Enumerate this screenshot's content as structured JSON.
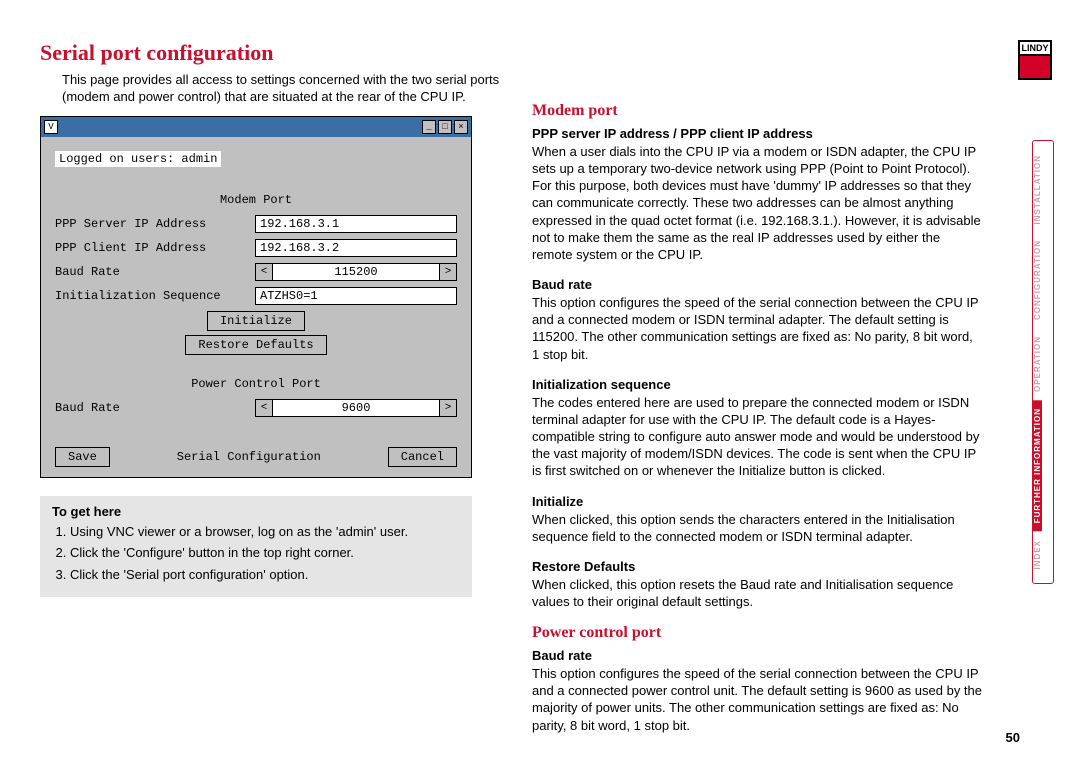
{
  "logo": {
    "text": "LINDY"
  },
  "title": "Serial port configuration",
  "intro": "This page provides all access to settings concerned with the two serial ports (modem and power control) that are situated at the rear of the CPU IP.",
  "screenshot": {
    "logged_on": "Logged on users: admin",
    "modem_section": "Modem Port",
    "labels": {
      "ppp_server": "PPP Server IP Address",
      "ppp_client": "PPP Client IP Address",
      "baud": "Baud Rate",
      "init_seq": "Initialization Sequence"
    },
    "values": {
      "ppp_server": "192.168.3.1",
      "ppp_client": "192.168.3.2",
      "modem_baud": "115200",
      "init_seq": "ATZHS0=1",
      "power_baud": "9600"
    },
    "buttons": {
      "initialize": "Initialize",
      "restore": "Restore Defaults",
      "save": "Save",
      "cancel": "Cancel"
    },
    "power_section": "Power Control Port",
    "bottom_title": "Serial Configuration"
  },
  "howto": {
    "heading": "To get here",
    "steps": [
      "Using VNC viewer or a browser, log on as the 'admin' user.",
      "Click the 'Configure' button in the top right corner.",
      "Click the 'Serial port configuration' option."
    ]
  },
  "right": {
    "modem_heading": "Modem port",
    "ppp": {
      "h": "PPP server IP address / PPP client IP address",
      "p": "When a user dials into the CPU IP via a modem or ISDN adapter, the CPU IP sets up a temporary two-device network using PPP (Point to Point Protocol). For this purpose, both devices must have 'dummy' IP addresses so that they can communicate correctly. These two addresses can be almost anything expressed in the quad octet format (i.e. 192.168.3.1.). However, it is advisable not to make them the same as the real IP addresses used by either the remote system or the CPU IP."
    },
    "baud1": {
      "h": "Baud rate",
      "p": "This option configures the speed of the serial connection between the CPU IP and a connected modem or ISDN terminal adapter. The default setting is 115200. The other communication settings are fixed as: No parity, 8 bit word, 1 stop bit."
    },
    "initseq": {
      "h": "Initialization sequence",
      "p": "The codes entered here are used to prepare the connected modem or ISDN terminal adapter for use with the CPU IP. The default code is a Hayes-compatible string to configure auto answer mode and would be understood by the vast majority of modem/ISDN devices. The code is sent when the CPU IP is first switched on or whenever the Initialize button is clicked."
    },
    "init": {
      "h": "Initialize",
      "p": "When clicked, this option sends the characters entered in the Initialisation sequence field to the connected modem or ISDN terminal adapter."
    },
    "restore": {
      "h": "Restore Defaults",
      "p": "When clicked, this option resets the Baud rate and Initialisation sequence values to their original default settings."
    },
    "power_heading": "Power control port",
    "baud2": {
      "h": "Baud rate",
      "p": "This option configures the speed of the serial connection between the CPU IP and a connected power control unit. The default setting is 9600 as used by the majority of power units. The other communication settings are fixed as: No parity, 8 bit word, 1 stop bit."
    }
  },
  "sidenav": {
    "installation": "INSTALLATION",
    "configuration": "CONFIGURATION",
    "operation": "OPERATION",
    "further": "FURTHER INFORMATION",
    "index": "INDEX"
  },
  "page_number": "50"
}
